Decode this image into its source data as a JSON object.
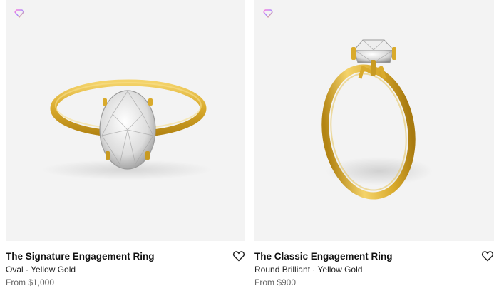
{
  "products": [
    {
      "title": "The Signature Engagement Ring",
      "subtitle": "Oval · Yellow Gold",
      "price": "From $1,000",
      "badge_icon": "diamond-icon",
      "wishlist_icon": "heart-icon"
    },
    {
      "title": "The Classic Engagement Ring",
      "subtitle": "Round Brilliant · Yellow Gold",
      "price": "From $900",
      "badge_icon": "diamond-icon",
      "wishlist_icon": "heart-icon"
    }
  ],
  "colors": {
    "card_background": "#f3f3f3",
    "gold": "#d9aa2c",
    "price_text": "#666666"
  }
}
